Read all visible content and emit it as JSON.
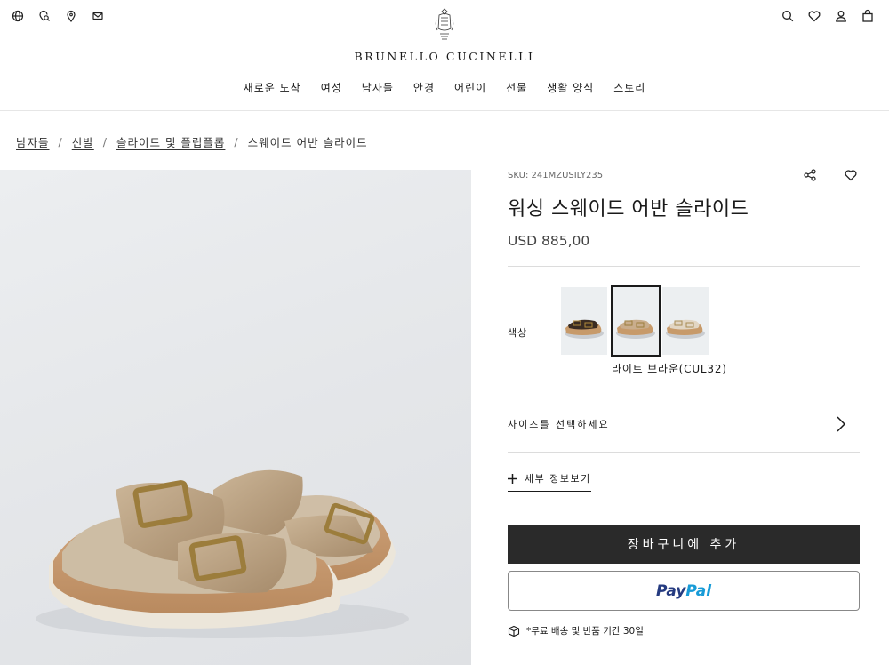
{
  "header": {
    "brand": "BRUNELLO CUCINELLI",
    "left_icons": [
      "globe-icon",
      "location-search-icon",
      "map-pin-icon",
      "mail-icon"
    ],
    "right_icons": [
      "search-icon",
      "heart-icon",
      "user-icon",
      "bag-icon"
    ]
  },
  "nav": {
    "items": [
      "새로운 도착",
      "여성",
      "남자들",
      "안경",
      "어린이",
      "선물",
      "생활 양식",
      "스토리"
    ]
  },
  "breadcrumb": {
    "items": [
      "남자들",
      "신발",
      "슬라이드 및 플립플롭"
    ],
    "current": "스웨이드 어반 슬라이드",
    "separator": "/"
  },
  "product": {
    "sku": "SKU: 241MZUSILY235",
    "title": "워싱 스웨이드 어반 슬라이드",
    "price": "USD 885,00",
    "color_label": "색상",
    "selected_color": "라이트 브라운(CUL32)",
    "swatches": [
      {
        "name": "dark",
        "color": "#3a2c22",
        "selected": false
      },
      {
        "name": "light-brown",
        "color": "#c9ad8c",
        "selected": true
      },
      {
        "name": "beige",
        "color": "#d8c7b0",
        "selected": false
      }
    ],
    "size_label": "사이즈를 선택하세요",
    "details_label": "세부 정보보기",
    "add_to_cart": "장바구니에 추가",
    "paypal_pay": "Pay",
    "paypal_pal": "Pal",
    "shipping_note": "*무료 배송 및 반품 기간 30일"
  },
  "colors": {
    "primary_button": "#2a2a2a",
    "paypal_dark": "#253b80",
    "paypal_light": "#179bd7",
    "suede": "#bda589"
  }
}
